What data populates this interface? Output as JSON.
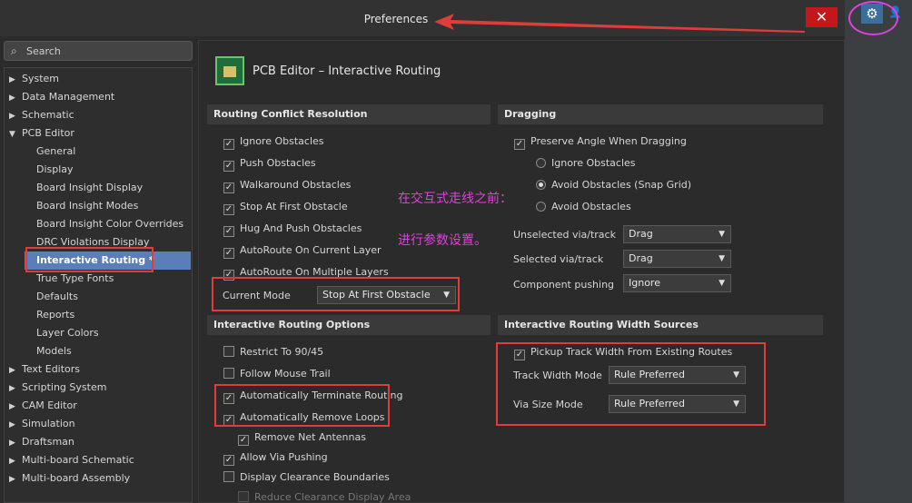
{
  "window": {
    "title": "Preferences",
    "close_icon": "✕"
  },
  "search": {
    "placeholder": "Search"
  },
  "tree": {
    "top": [
      "System",
      "Data Management",
      "Schematic"
    ],
    "pcb_editor": "PCB Editor",
    "pcb_children": [
      "General",
      "Display",
      "Board Insight Display",
      "Board Insight Modes",
      "Board Insight Color Overrides",
      "DRC Violations Display"
    ],
    "selected": "Interactive Routing *",
    "pcb_children_after": [
      "True Type Fonts",
      "Defaults",
      "Reports",
      "Layer Colors",
      "Models"
    ],
    "bottom": [
      "Text Editors",
      "Scripting System",
      "CAM Editor",
      "Simulation",
      "Draftsman",
      "Multi-board Schematic",
      "Multi-board Assembly"
    ]
  },
  "page": {
    "title": "PCB Editor – Interactive Routing"
  },
  "conflict": {
    "header": "Routing Conflict Resolution",
    "items": [
      {
        "label": "Ignore Obstacles",
        "checked": true
      },
      {
        "label": "Push Obstacles",
        "checked": true
      },
      {
        "label": "Walkaround Obstacles",
        "checked": true
      },
      {
        "label": "Stop At First Obstacle",
        "checked": true
      },
      {
        "label": "Hug And Push Obstacles",
        "checked": true
      },
      {
        "label": "AutoRoute On Current Layer",
        "checked": true
      },
      {
        "label": "AutoRoute On Multiple Layers",
        "checked": true
      }
    ],
    "current_mode_label": "Current Mode",
    "current_mode_value": "Stop At First Obstacle"
  },
  "dragging": {
    "header": "Dragging",
    "preserve_angle": "Preserve Angle When Dragging",
    "radios": [
      {
        "label": "Ignore Obstacles",
        "selected": false
      },
      {
        "label": "Avoid Obstacles (Snap Grid)",
        "selected": true
      },
      {
        "label": "Avoid Obstacles",
        "selected": false
      }
    ],
    "unselected_label": "Unselected via/track",
    "unselected_value": "Drag",
    "selected_label": "Selected via/track",
    "selected_value": "Drag",
    "component_label": "Component pushing",
    "component_value": "Ignore"
  },
  "options": {
    "header": "Interactive Routing Options",
    "items": [
      {
        "label": "Restrict To 90/45",
        "checked": false
      },
      {
        "label": "Follow Mouse Trail",
        "checked": false
      },
      {
        "label": "Automatically Terminate Routing",
        "checked": true
      },
      {
        "label": "Automatically Remove Loops",
        "checked": true
      },
      {
        "label": "Remove Net Antennas",
        "checked": true
      },
      {
        "label": "Allow Via Pushing",
        "checked": true
      },
      {
        "label": "Display Clearance Boundaries",
        "checked": false
      },
      {
        "label": "Reduce Clearance Display Area",
        "checked": false
      }
    ]
  },
  "width_sources": {
    "header": "Interactive Routing Width Sources",
    "pickup": "Pickup Track Width From Existing Routes",
    "track_label": "Track Width Mode",
    "track_value": "Rule Preferred",
    "via_label": "Via Size Mode",
    "via_value": "Rule Preferred"
  },
  "annotation": {
    "line1": "在交互式走线之前：",
    "line2": "进行参数设置。"
  },
  "colors": {
    "accent": "#5a7fb8",
    "close": "#c5161c",
    "highlight": "#e23b3b",
    "annotation": "#e03ee0"
  }
}
